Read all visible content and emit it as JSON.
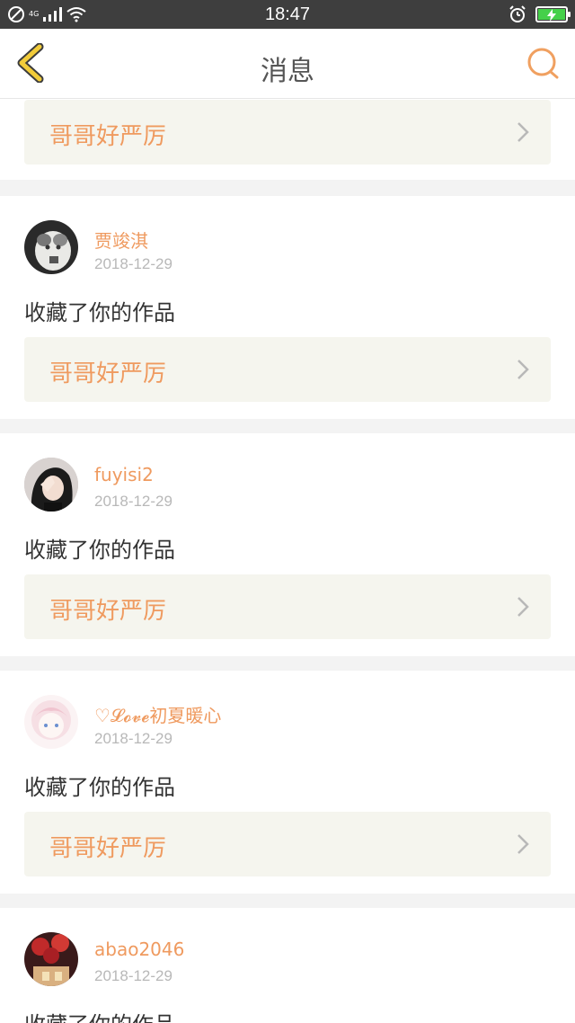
{
  "status_bar": {
    "time": "18:47",
    "network": "4G",
    "icons": [
      "no-disturb-icon",
      "signal-icon",
      "wifi-icon",
      "alarm-icon",
      "battery-charging-icon"
    ],
    "battery_color": "#45d04a"
  },
  "nav": {
    "title": "消息",
    "back_icon": "chevron-left-icon",
    "search_icon": "search-icon",
    "accent": "#f0a060"
  },
  "top_partial": {
    "link_label": "哥哥好严厉"
  },
  "messages": [
    {
      "name": "贾竣淇",
      "date": "2018-12-29",
      "action": "收藏了你的作品",
      "link_label": "哥哥好严厉"
    },
    {
      "name": "fuyisi2",
      "date": "2018-12-29",
      "action": "收藏了你的作品",
      "link_label": "哥哥好严厉"
    },
    {
      "name": "♡𝓛𝓸𝓿𝓮初夏暖心",
      "date": "2018-12-29",
      "action": "收藏了你的作品",
      "link_label": "哥哥好严厉"
    },
    {
      "name": "abao2046",
      "date": "2018-12-29",
      "action": "收藏了你的作品"
    }
  ],
  "colors": {
    "name": "#ef9a5f",
    "link_bg": "#f5f5ee",
    "separator": "#f3f3f3"
  }
}
